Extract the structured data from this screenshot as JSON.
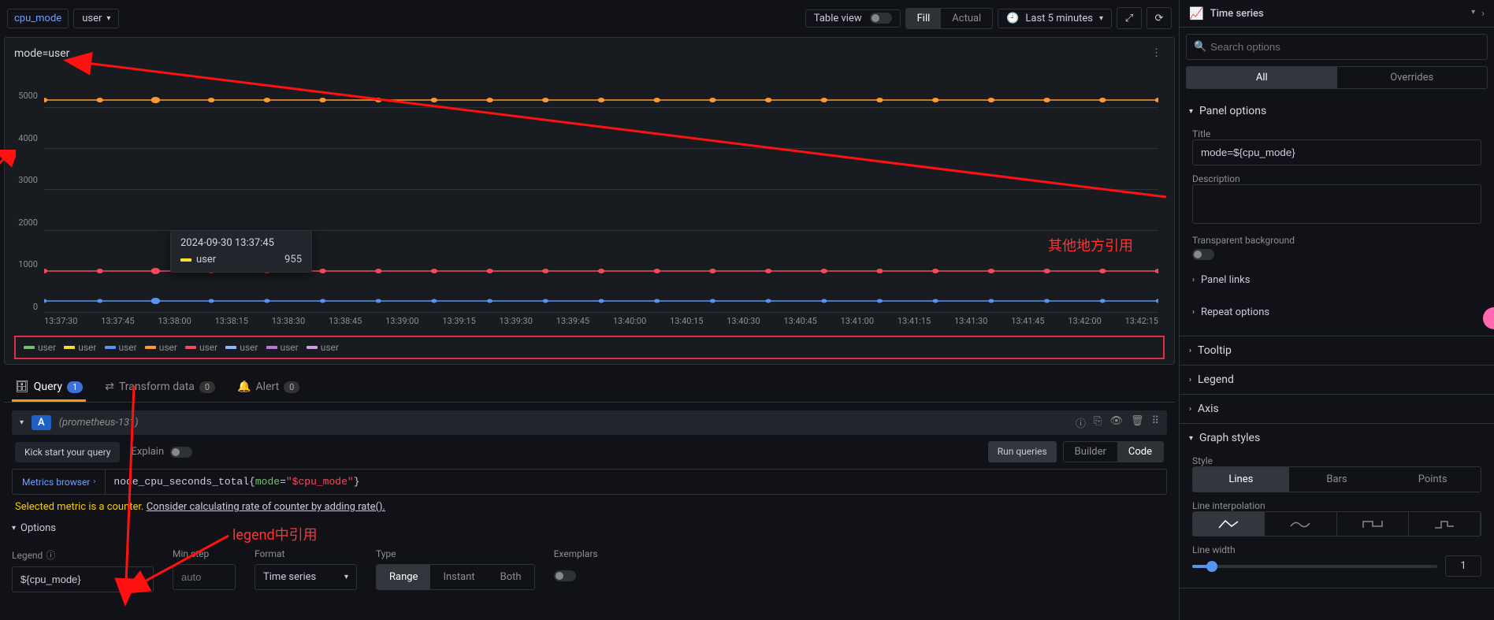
{
  "toolbar": {
    "var_name": "cpu_mode",
    "var_value": "user",
    "table_view": "Table view",
    "fill": "Fill",
    "actual": "Actual",
    "time_range": "Last 5 minutes"
  },
  "panel": {
    "title": "mode=user",
    "tooltip": {
      "timestamp": "2024-09-30 13:37:45",
      "series": "user",
      "value": "955"
    },
    "y_ticks": [
      "5000",
      "4000",
      "3000",
      "2000",
      "1000",
      "0"
    ],
    "x_ticks": [
      "13:37:30",
      "13:37:45",
      "13:38:00",
      "13:38:15",
      "13:38:30",
      "13:38:45",
      "13:39:00",
      "13:39:15",
      "13:39:30",
      "13:39:45",
      "13:40:00",
      "13:40:15",
      "13:40:30",
      "13:40:45",
      "13:41:00",
      "13:41:15",
      "13:41:30",
      "13:41:45",
      "13:42:00",
      "13:42:15"
    ],
    "legend_items": [
      {
        "label": "user",
        "color": "#73BF69"
      },
      {
        "label": "user",
        "color": "#FADE2A"
      },
      {
        "label": "user",
        "color": "#5794F2"
      },
      {
        "label": "user",
        "color": "#FF9830"
      },
      {
        "label": "user",
        "color": "#F2495C"
      },
      {
        "label": "user",
        "color": "#8AB8FF"
      },
      {
        "label": "user",
        "color": "#B877D9"
      },
      {
        "label": "user",
        "color": "#C9A0DC"
      }
    ]
  },
  "chart_data": {
    "type": "line",
    "title": "mode=user",
    "x": [
      "13:37:30",
      "13:37:45",
      "13:38:00",
      "13:38:15",
      "13:38:30",
      "13:38:45",
      "13:39:00",
      "13:39:15",
      "13:39:30",
      "13:39:45",
      "13:40:00",
      "13:40:15",
      "13:40:30",
      "13:40:45",
      "13:41:00",
      "13:41:15",
      "13:41:30",
      "13:41:45",
      "13:42:00",
      "13:42:15"
    ],
    "series": [
      {
        "name": "user",
        "color": "#73BF69",
        "approx_y": 1000
      },
      {
        "name": "user",
        "color": "#FADE2A",
        "approx_y": 1000
      },
      {
        "name": "user",
        "color": "#5794F2",
        "approx_y": 300
      },
      {
        "name": "user",
        "color": "#FF9830",
        "approx_y": 5200
      },
      {
        "name": "user",
        "color": "#F2495C",
        "approx_y": 955
      },
      {
        "name": "user",
        "color": "#8AB8FF",
        "approx_y": 300
      },
      {
        "name": "user",
        "color": "#B877D9",
        "approx_y": 300
      },
      {
        "name": "user",
        "color": "#C9A0DC",
        "approx_y": 300
      }
    ],
    "ylim": [
      0,
      5500
    ],
    "xlabel": "",
    "ylabel": ""
  },
  "tabs": {
    "query": "Query",
    "query_n": "1",
    "transform": "Transform data",
    "transform_n": "0",
    "alert": "Alert",
    "alert_n": "0"
  },
  "query": {
    "ref_id": "A",
    "datasource": "(prometheus-131)",
    "kickstart": "Kick start your query",
    "explain": "Explain",
    "run": "Run queries",
    "builder": "Builder",
    "code": "Code",
    "metrics_browser": "Metrics browser",
    "expr_fn": "node_cpu_seconds_total",
    "expr_key": "mode",
    "expr_val": "\"$cpu_mode\"",
    "hint_prefix": "Selected metric is a counter.",
    "hint_link": "Consider calculating rate of counter by adding rate().",
    "options_label": "Options",
    "legend_label": "Legend",
    "legend_value": "${cpu_mode}",
    "minstep_label": "Min step",
    "minstep_ph": "auto",
    "format_label": "Format",
    "format_value": "Time series",
    "type_label": "Type",
    "type_range": "Range",
    "type_instant": "Instant",
    "type_both": "Both",
    "exemplars": "Exemplars"
  },
  "right": {
    "viz_name": "Time series",
    "search_ph": "Search options",
    "all": "All",
    "overrides": "Overrides",
    "panel_options": "Panel options",
    "title_lbl": "Title",
    "title_val": "mode=${cpu_mode}",
    "desc_lbl": "Description",
    "transparent": "Transparent background",
    "panel_links": "Panel links",
    "repeat": "Repeat options",
    "tooltip": "Tooltip",
    "legend": "Legend",
    "axis": "Axis",
    "graph_styles": "Graph styles",
    "style_lbl": "Style",
    "style_lines": "Lines",
    "style_bars": "Bars",
    "style_points": "Points",
    "interp_lbl": "Line interpolation",
    "width_lbl": "Line width",
    "width_val": "1"
  },
  "annotations": {
    "anno1": "其他地方引用",
    "anno2": "legend中引用"
  }
}
